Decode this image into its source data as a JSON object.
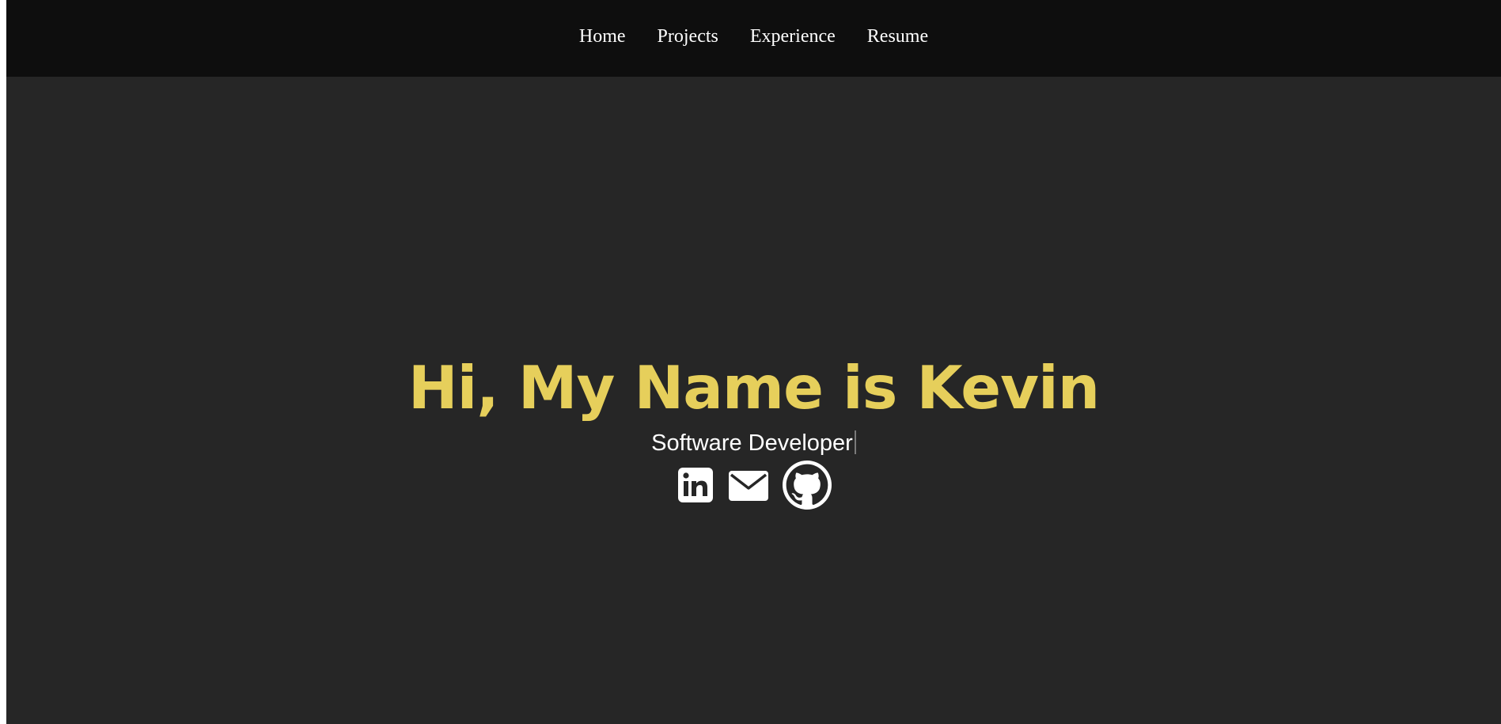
{
  "nav": {
    "items": [
      {
        "label": "Home"
      },
      {
        "label": "Projects"
      },
      {
        "label": "Experience"
      },
      {
        "label": "Resume"
      }
    ]
  },
  "hero": {
    "title": "Hi, My Name is Kevin",
    "subtitle": "Software Developer"
  },
  "social": {
    "icons": [
      "linkedin-icon",
      "email-icon",
      "github-icon"
    ]
  },
  "colors": {
    "page_background": "#262626",
    "navbar_background": "#0e0e0e",
    "accent": "#e6cf5b",
    "text": "#ffffff"
  }
}
